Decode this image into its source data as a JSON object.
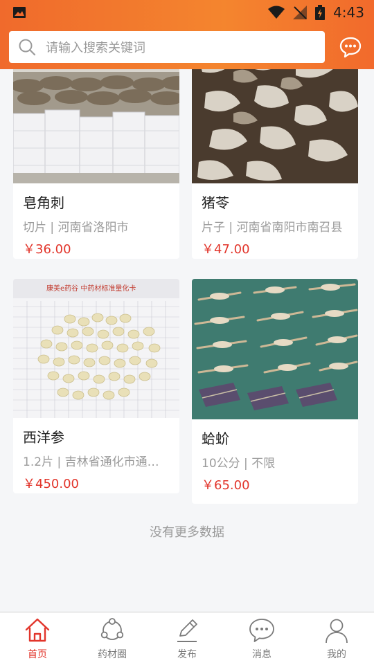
{
  "status": {
    "time": "4:43"
  },
  "search": {
    "placeholder": "请输入搜索关键词"
  },
  "products": [
    {
      "name": "皂角刺",
      "spec": "切片 | 河南省洛阳市",
      "price": "￥36.00"
    },
    {
      "name": "猪苓",
      "spec": "片子 | 河南省南阳市南召县",
      "price": "￥47.00"
    },
    {
      "name": "西洋参",
      "spec": "1.2片 | 吉林省通化市通…",
      "price": "￥450.00"
    },
    {
      "name": "蛤蚧",
      "spec": "10公分 | 不限",
      "price": "￥65.00"
    }
  ],
  "card_image_text": "康美e药谷 中药材标准量化卡",
  "footer": {
    "no_more": "没有更多数据"
  },
  "tabs": [
    {
      "label": "首页",
      "icon": "home-icon"
    },
    {
      "label": "药材圈",
      "icon": "share-circle-icon"
    },
    {
      "label": "发布",
      "icon": "pencil-icon"
    },
    {
      "label": "消息",
      "icon": "chat-icon"
    },
    {
      "label": "我的",
      "icon": "user-icon"
    }
  ],
  "colors": {
    "accent": "#e2352b",
    "header_start": "#f06a2c",
    "header_end": "#f4852e"
  }
}
